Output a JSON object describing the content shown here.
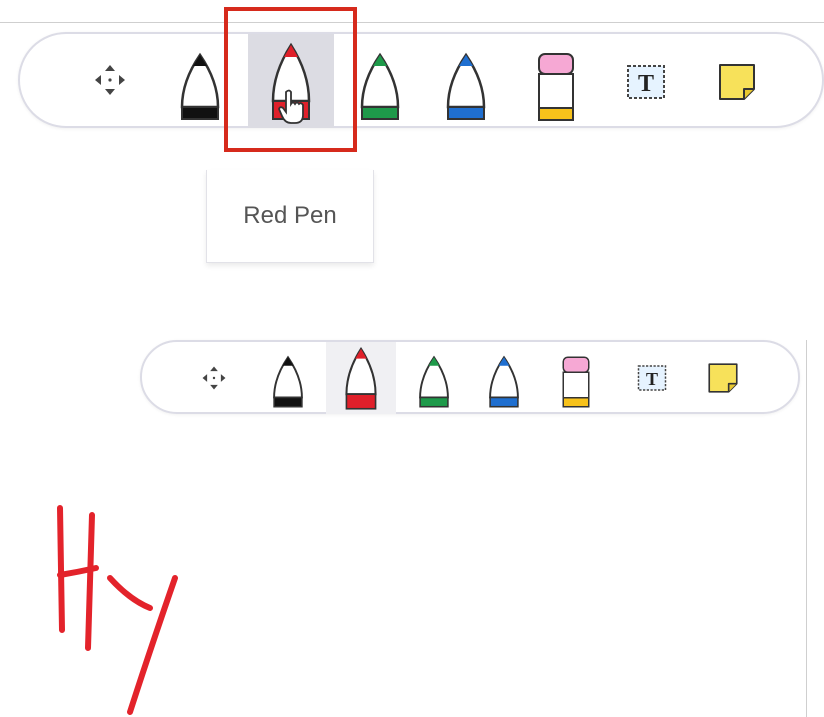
{
  "toolbar_top": {
    "tools": [
      {
        "id": "move",
        "icon": "move-arrows-icon",
        "label": ""
      },
      {
        "id": "black-pen",
        "icon": "black-pen-icon",
        "color": "#111111"
      },
      {
        "id": "red-pen",
        "icon": "red-pen-icon",
        "color": "#e0202a",
        "active": true
      },
      {
        "id": "green-pen",
        "icon": "green-pen-icon",
        "color": "#1e9a4a"
      },
      {
        "id": "blue-pen",
        "icon": "blue-pen-icon",
        "color": "#1f6fd0"
      },
      {
        "id": "highlighter",
        "icon": "highlighter-icon",
        "color": "#f7c21b",
        "cap": "#f6a8d4"
      },
      {
        "id": "text",
        "icon": "text-box-icon"
      },
      {
        "id": "sticky",
        "icon": "sticky-note-icon",
        "color": "#f7e15a"
      }
    ],
    "tooltip": "Red Pen"
  },
  "toolbar_bottom": {
    "active_tool": "red-pen"
  },
  "canvas": {
    "handwriting": "Hy",
    "ink_color": "#e3232b"
  }
}
